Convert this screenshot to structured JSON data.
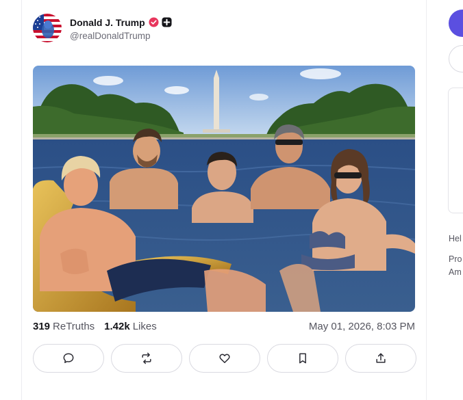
{
  "post": {
    "author": {
      "display_name": "Donald J. Trump",
      "handle": "@realDonaldTrump",
      "verified_icon": "verified-badge-icon",
      "plus_icon": "plus-badge-icon",
      "avatar_icon": "avatar-american-flag"
    },
    "media": {
      "icon": "post-image-photo",
      "alt_visible": ""
    },
    "stats": {
      "retruths_count": "319",
      "retruths_label": "ReTruths",
      "likes_count": "1.42k",
      "likes_label": "Likes"
    },
    "timestamp": "May 01, 2026, 8:03 PM",
    "actions": [
      {
        "name": "reply",
        "icon": "comment-icon"
      },
      {
        "name": "retruth",
        "icon": "repost-icon"
      },
      {
        "name": "like",
        "icon": "heart-icon"
      },
      {
        "name": "bookmark",
        "icon": "bookmark-icon"
      },
      {
        "name": "share",
        "icon": "share-icon"
      }
    ]
  },
  "sidebar": {
    "text_1": "Hel",
    "text_2": "Pro",
    "text_3": "Am"
  },
  "colors": {
    "accent": "#5b4fe0",
    "verified": "#e8365d",
    "text_primary": "#15151a",
    "text_secondary": "#55555f",
    "border": "#d9d9e0"
  }
}
